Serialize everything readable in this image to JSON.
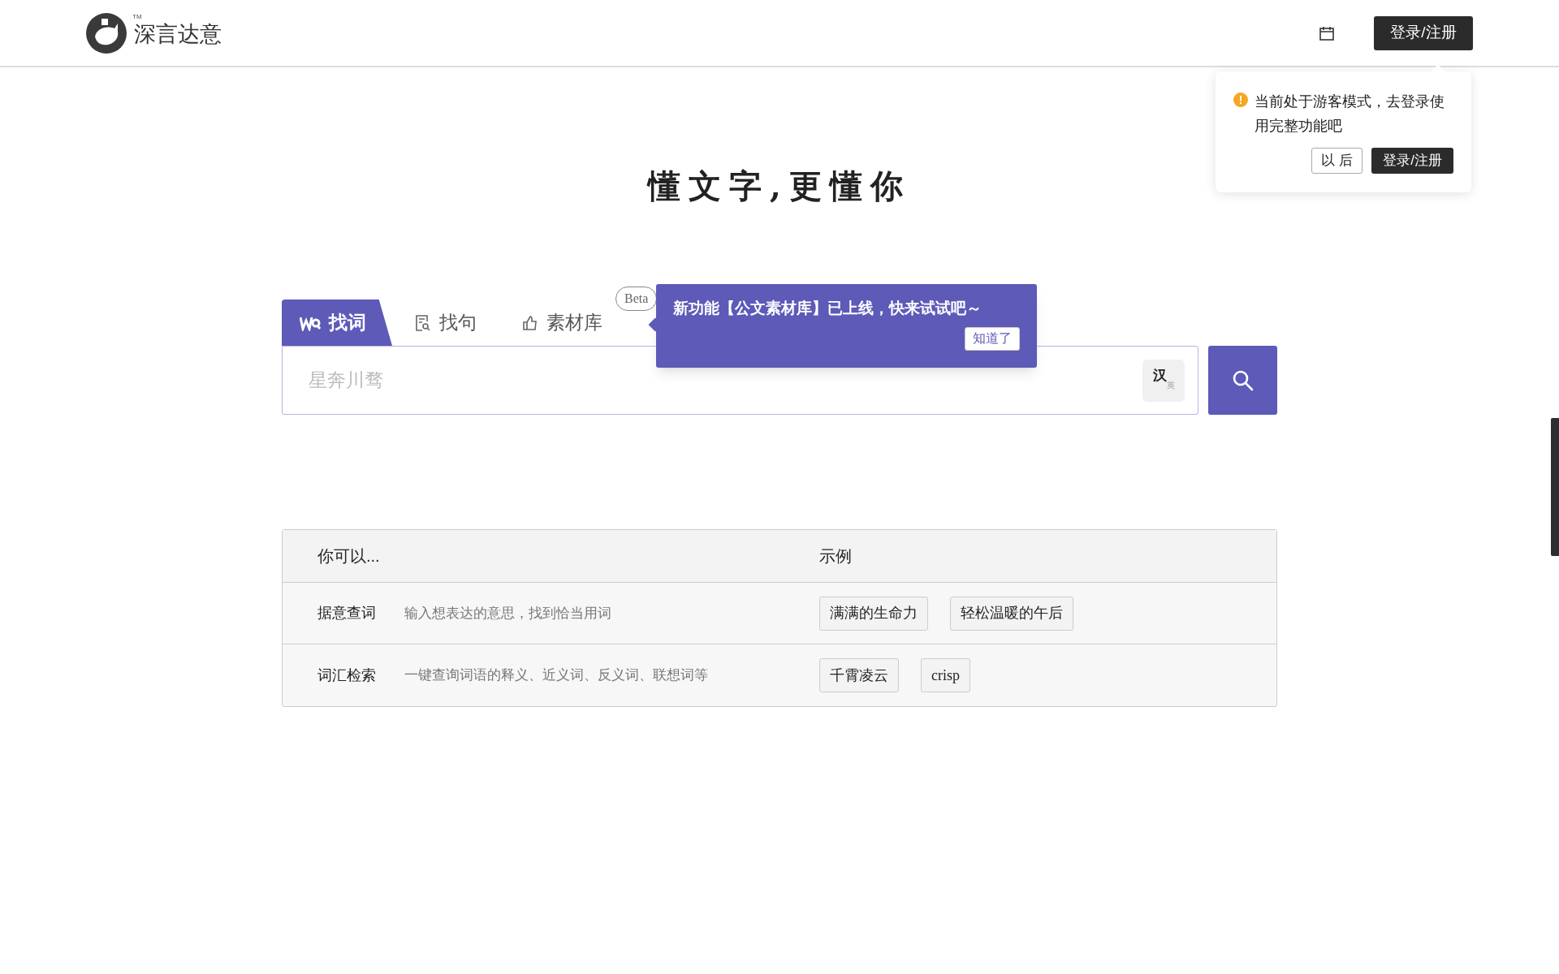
{
  "header": {
    "logo_text": "深言达意",
    "trademark": "TM",
    "login_button": "登录/注册"
  },
  "guest_popover": {
    "message": "当前处于游客模式，去登录使用完整功能吧",
    "later_button": "以 后",
    "login_button": "登录/注册"
  },
  "slogan": "懂文字,更懂你",
  "tabs": [
    {
      "kind": "word",
      "label": "找词",
      "selected": true
    },
    {
      "kind": "sentence",
      "label": "找句",
      "selected": false
    },
    {
      "kind": "material",
      "label": "素材库",
      "selected": false,
      "badge": "Beta"
    }
  ],
  "feature_tooltip": {
    "text": "新功能【公文素材库】已上线，快来试试吧～",
    "button": "知道了"
  },
  "search": {
    "placeholder": "星奔川骛",
    "lang_toggle": {
      "from": "汉",
      "to": "英"
    }
  },
  "table": {
    "columns": [
      "你可以...",
      "示例"
    ],
    "rows": [
      {
        "title": "据意查词",
        "description": "输入想表达的意思，找到恰当用词",
        "examples": [
          "满满的生命力",
          "轻松温暖的午后"
        ]
      },
      {
        "title": "词汇检索",
        "description": "一键查询词语的释义、近义词、反义词、联想词等",
        "examples": [
          "千霄凌云",
          "crisp"
        ]
      }
    ]
  }
}
